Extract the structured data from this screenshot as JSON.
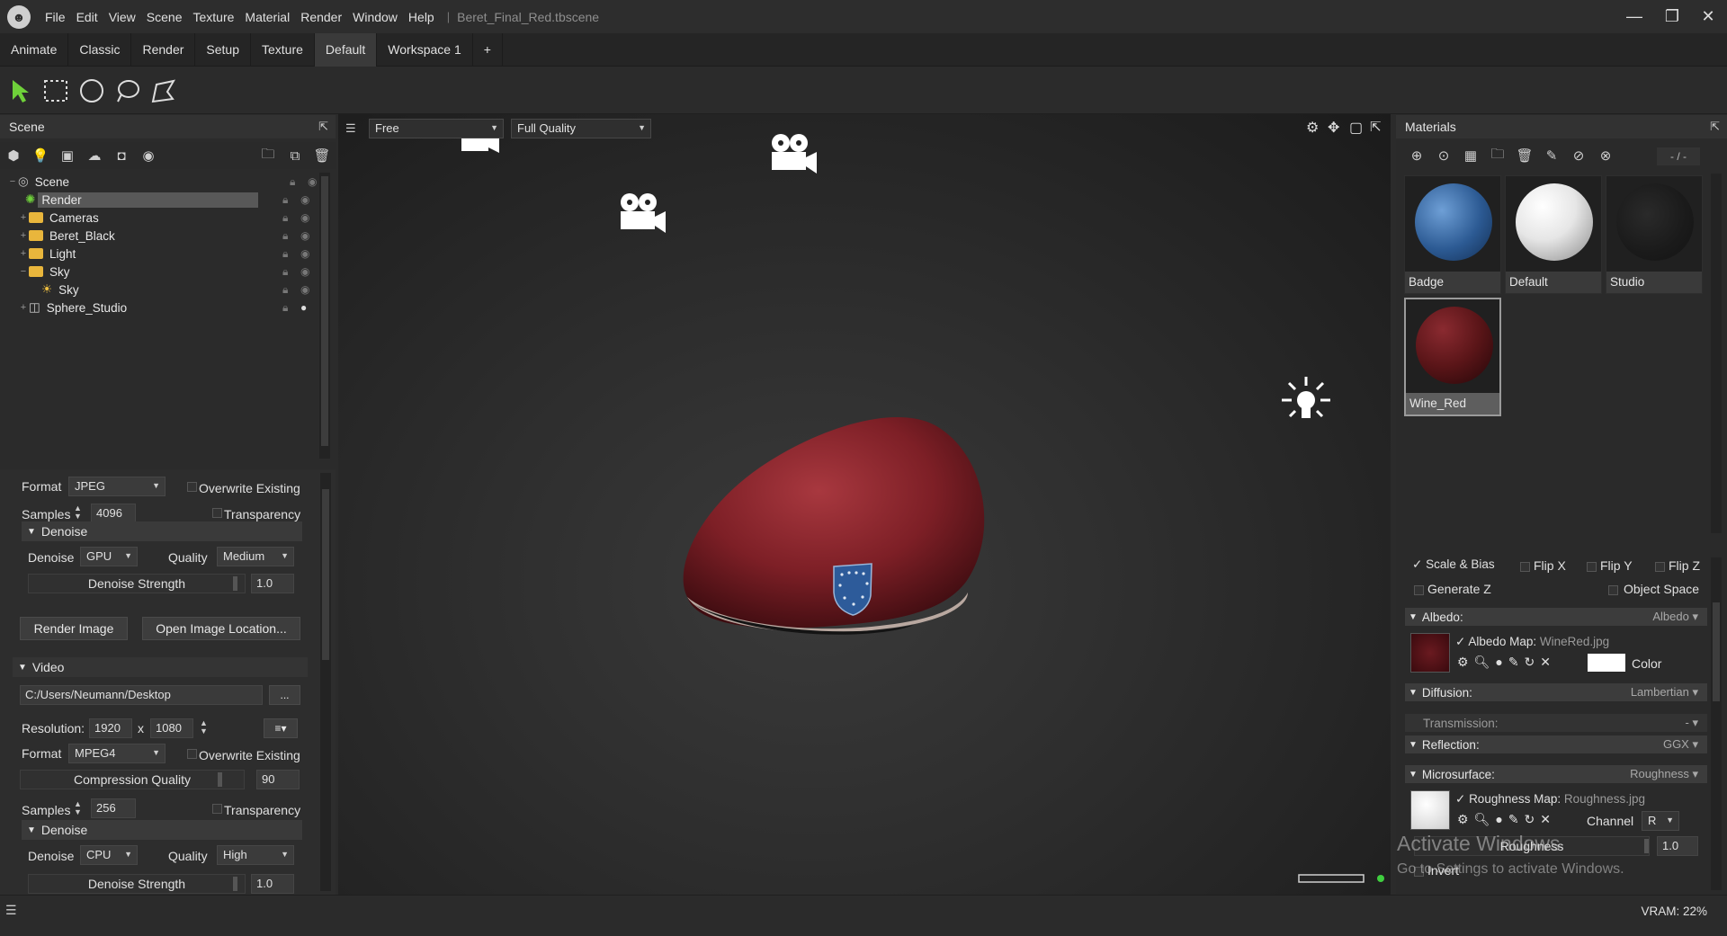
{
  "title_bar": {
    "menus": [
      "File",
      "Edit",
      "View",
      "Scene",
      "Texture",
      "Material",
      "Render",
      "Window",
      "Help"
    ],
    "document": "Beret_Final_Red.tbscene"
  },
  "workspace_tabs": [
    "Animate",
    "Classic",
    "Render",
    "Setup",
    "Texture",
    "Default",
    "Workspace 1",
    "+"
  ],
  "active_tab": "Default",
  "scene_panel": {
    "title": "Scene",
    "tree": [
      {
        "label": "Scene",
        "level": 0,
        "icon": "scene-icon"
      },
      {
        "label": "Render",
        "level": 1,
        "icon": "render-gear-icon",
        "selected": true
      },
      {
        "label": "Cameras",
        "level": 1,
        "icon": "folder-icon"
      },
      {
        "label": "Beret_Black",
        "level": 1,
        "icon": "folder-icon"
      },
      {
        "label": "Light",
        "level": 1,
        "icon": "folder-icon"
      },
      {
        "label": "Sky",
        "level": 1,
        "icon": "folder-icon"
      },
      {
        "label": "Sky",
        "level": 2,
        "icon": "sky-icon"
      },
      {
        "label": "Sphere_Studio",
        "level": 1,
        "icon": "object-icon"
      }
    ]
  },
  "render_settings": {
    "image": {
      "format_label": "Format",
      "format": "JPEG",
      "overwrite": "Overwrite Existing",
      "samples_label": "Samples",
      "samples": "4096",
      "transparency": "Transparency",
      "denoise_section": "Denoise",
      "denoise_label": "Denoise",
      "denoise": "GPU",
      "quality_label": "Quality",
      "quality": "Medium",
      "strength_label": "Denoise Strength",
      "strength": "1.0",
      "render_button": "Render Image",
      "open_button": "Open Image Location..."
    },
    "video": {
      "section": "Video",
      "path": "C:/Users/Neumann/Desktop",
      "browse": "...",
      "resolution_label": "Resolution:",
      "res_w": "1920",
      "res_x": "x",
      "res_h": "1080",
      "format_label": "Format",
      "format": "MPEG4",
      "overwrite": "Overwrite Existing",
      "compression_label": "Compression Quality",
      "compression": "90",
      "samples_label": "Samples",
      "samples": "256",
      "transparency": "Transparency",
      "denoise_section": "Denoise",
      "denoise_label": "Denoise",
      "denoise": "CPU",
      "quality_label": "Quality",
      "quality": "High",
      "strength_label": "Denoise Strength",
      "strength": "1.0"
    }
  },
  "viewport": {
    "camera_mode": "Free",
    "quality": "Full Quality"
  },
  "materials": {
    "title": "Materials",
    "counter": "- / -",
    "items": [
      {
        "name": "Badge",
        "color": "#2f5f9a"
      },
      {
        "name": "Default",
        "color": "#f2f2f2"
      },
      {
        "name": "Studio",
        "color": "#1c1c1c"
      },
      {
        "name": "Wine_Red",
        "color": "#5a1518",
        "selected": true
      }
    ],
    "flags": {
      "scale_bias": "Scale & Bias",
      "flip_x": "Flip X",
      "flip_y": "Flip Y",
      "flip_z": "Flip Z",
      "generate_z": "Generate Z",
      "object_space": "Object Space"
    },
    "albedo": {
      "header": "Albedo:",
      "value": "Albedo",
      "map_label": "Albedo Map:",
      "map_file": "WineRed.jpg",
      "color_label": "Color"
    },
    "diffusion": {
      "header": "Diffusion:",
      "value": "Lambertian"
    },
    "transmission": {
      "header": "Transmission:",
      "value": "-"
    },
    "reflection": {
      "header": "Reflection:",
      "value": "GGX"
    },
    "microsurface": {
      "header": "Microsurface:",
      "value": "Roughness",
      "map_label": "Roughness Map:",
      "map_file": "Roughness.jpg",
      "channel_label": "Channel",
      "channel": "R",
      "roughness_label": "Roughness",
      "roughness": "1.0",
      "invert": "Invert"
    }
  },
  "status_bar": {
    "vram": "VRAM: 22%"
  },
  "watermark": {
    "line1": "Activate Windows",
    "line2": "Go to Settings to activate Windows."
  }
}
